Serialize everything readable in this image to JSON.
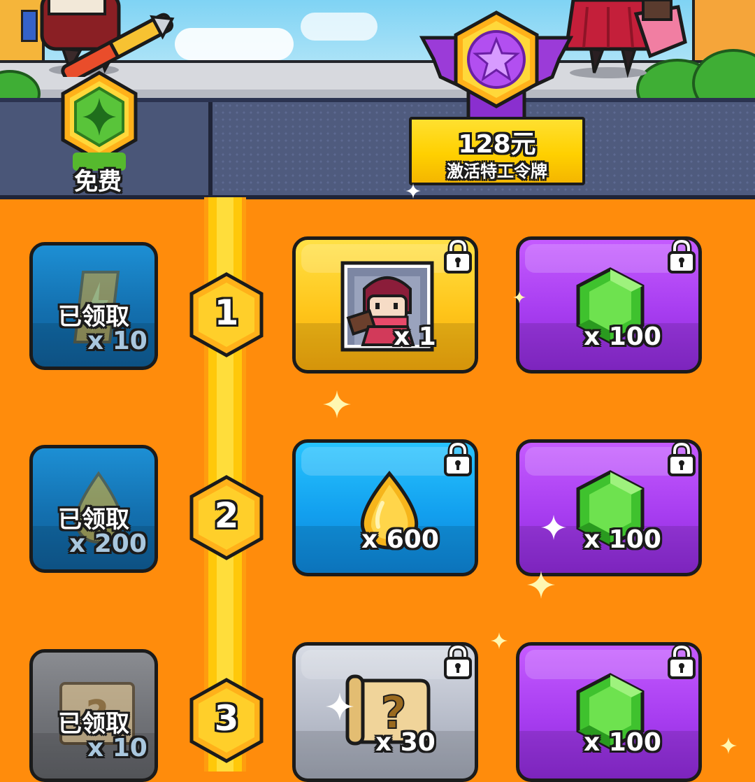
{
  "header": {
    "free_label": "免费",
    "activate_price": "128元",
    "activate_label": "激活特工令牌"
  },
  "levels": [
    {
      "number": "1",
      "free": {
        "status": "已领取",
        "quantity": "x 10",
        "icon": "energy-card-icon",
        "claimed": true
      },
      "premium": [
        {
          "quantity": "x 1",
          "icon": "ninja-agent-portrait-icon",
          "locked": true
        },
        {
          "quantity": "x 100",
          "icon": "green-gem-icon",
          "locked": true
        }
      ]
    },
    {
      "number": "2",
      "free": {
        "status": "已领取",
        "quantity": "x 200",
        "icon": "gold-drop-icon",
        "claimed": true
      },
      "premium": [
        {
          "quantity": "x 600",
          "icon": "gold-drop-icon",
          "locked": true
        },
        {
          "quantity": "x 100",
          "icon": "green-gem-icon",
          "locked": true
        }
      ]
    },
    {
      "number": "3",
      "free": {
        "status": "已领取",
        "quantity": "x 10",
        "icon": "mystery-scroll-icon",
        "claimed": true
      },
      "premium": [
        {
          "quantity": "x 30",
          "icon": "mystery-scroll-icon",
          "locked": true
        },
        {
          "quantity": "x 100",
          "icon": "green-gem-icon",
          "locked": true
        }
      ]
    }
  ],
  "colors": {
    "background": "#ff8c0c",
    "track": "#ffc80a",
    "header": "#3f4a6b",
    "premium_purple": "#a73df0",
    "premium_yellow": "#ffc51a",
    "premium_blue": "#129fee"
  }
}
